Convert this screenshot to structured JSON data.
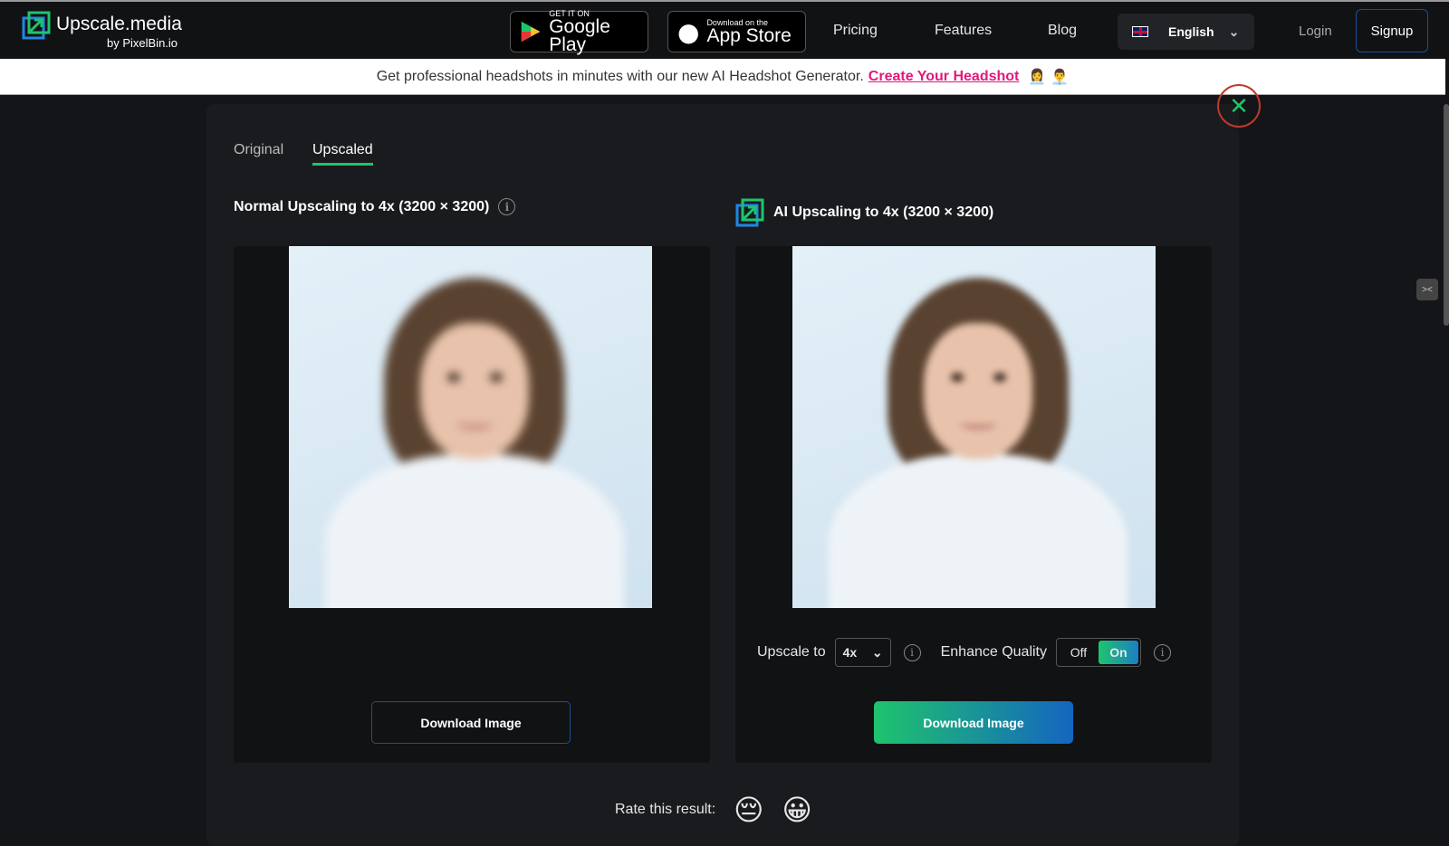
{
  "header": {
    "logo_name": "Upscale.media",
    "logo_by": "by PixelBin.io",
    "google_play": {
      "small": "GET IT ON",
      "big": "Google Play"
    },
    "app_store": {
      "small": "Download on the",
      "big": "App Store"
    },
    "nav": [
      "Pricing",
      "Features",
      "Blog"
    ],
    "language": "English",
    "login": "Login",
    "signup": "Signup"
  },
  "banner": {
    "text": "Get professional headshots in minutes with our new AI Headshot Generator.",
    "link": "Create Your Headshot"
  },
  "tabs": [
    "Original",
    "Upscaled"
  ],
  "active_tab": "Upscaled",
  "left": {
    "title": "Normal Upscaling to 4x (3200 × 3200)",
    "download": "Download Image"
  },
  "right": {
    "title": "AI Upscaling to 4x (3200 × 3200)",
    "download": "Download Image",
    "upscale_label": "Upscale to",
    "upscale_value": "4x",
    "enhance_label": "Enhance Quality",
    "toggle_off": "Off",
    "toggle_on": "On",
    "enhance_state": "On"
  },
  "rate": {
    "label": "Rate this result:",
    "emojis": [
      "😔",
      "😀"
    ]
  },
  "colors": {
    "accent_green": "#1ec46d",
    "link_pink": "#e0197d",
    "gradient_end": "#1565c0"
  }
}
